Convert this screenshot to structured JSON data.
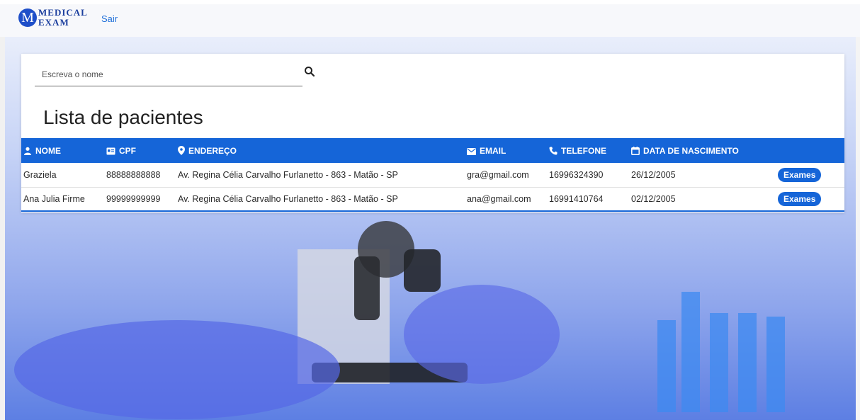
{
  "navbar": {
    "logo_letter": "M",
    "logo_line1": "MEDICAL",
    "logo_line2": "EXAM",
    "logout_label": "Sair"
  },
  "search": {
    "value": "",
    "placeholder": "Escreva o nome",
    "icon": "search-icon"
  },
  "page_title": "Lista de pacientes",
  "table": {
    "headers": {
      "nome": "NOME",
      "cpf": "CPF",
      "endereco": "ENDEREÇO",
      "email": "EMAIL",
      "telefone": "TELEFONE",
      "data_nascimento": "DATA DE NASCIMENTO"
    },
    "header_icons": [
      "person-icon",
      "id-card-icon",
      "location-pin-icon",
      "envelope-icon",
      "phone-icon",
      "calendar-icon"
    ],
    "rows": [
      {
        "nome": "Graziela",
        "cpf": "88888888888",
        "endereco": "Av. Regina Célia Carvalho Furlanetto - 863 - Matão - SP",
        "email": "gra@gmail.com",
        "telefone": "16996324390",
        "data_nascimento": "26/12/2005",
        "action_label": "Exames"
      },
      {
        "nome": "Ana Julia Firme",
        "cpf": "99999999999",
        "endereco": "Av. Regina Célia Carvalho Furlanetto - 863 - Matão - SP",
        "email": "ana@gmail.com",
        "telefone": "16991410764",
        "data_nascimento": "02/12/2005",
        "action_label": "Exames"
      }
    ]
  },
  "colors": {
    "primary": "#1565d8",
    "logo": "#1e4fc9",
    "link": "#1e6fd9"
  }
}
